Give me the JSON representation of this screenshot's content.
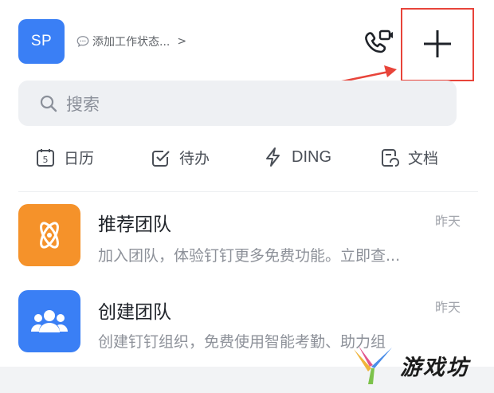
{
  "header": {
    "avatar_text": "SP",
    "status_text": "添加工作状态...",
    "status_chevron": ">",
    "call_icon": "phone-video-icon",
    "add_icon": "plus-icon",
    "highlight_color": "#e8443a"
  },
  "search": {
    "placeholder": "搜索",
    "icon": "search-icon"
  },
  "quick_tabs": [
    {
      "label": "日历",
      "icon": "calendar-icon",
      "badge": "5"
    },
    {
      "label": "待办",
      "icon": "checkbox-icon"
    },
    {
      "label": "DING",
      "icon": "lightning-icon"
    },
    {
      "label": "文档",
      "icon": "document-icon"
    }
  ],
  "conversations": [
    {
      "title": "推荐团队",
      "subtitle": "加入团队，体验钉钉更多免费功能。立即查...",
      "time": "昨天",
      "icon": "atom-team-icon",
      "color": "#f5922a"
    },
    {
      "title": "创建团队",
      "subtitle": "创建钉钉组织，免费使用智能考勤、助力组",
      "time": "昨天",
      "icon": "people-group-icon",
      "color": "#3a7ff5"
    }
  ],
  "watermark": {
    "text": "游戏坊",
    "logo_icon": "y-logo-icon"
  }
}
